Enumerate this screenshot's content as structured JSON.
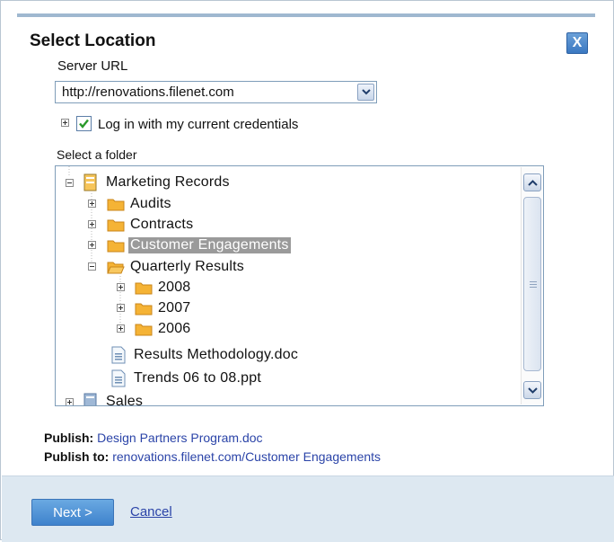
{
  "dialog": {
    "title": "Select Location",
    "close_label": "X"
  },
  "server": {
    "label": "Server URL",
    "url_value": "http://renovations.filenet.com"
  },
  "credentials": {
    "label": "Log in with my current credentials",
    "checked": true
  },
  "folder_section": {
    "label": "Select a folder"
  },
  "tree": {
    "items": [
      {
        "label": "Marketing Records",
        "type": "cabinet",
        "expanded": true
      },
      {
        "label": "Audits",
        "type": "folder",
        "expanded": false
      },
      {
        "label": "Contracts",
        "type": "folder",
        "expanded": false
      },
      {
        "label": "Customer Engagements",
        "type": "folder",
        "expanded": false,
        "selected": true
      },
      {
        "label": "Quarterly Results",
        "type": "folder-open",
        "expanded": true
      },
      {
        "label": "2008",
        "type": "folder",
        "expanded": false
      },
      {
        "label": "2007",
        "type": "folder",
        "expanded": false
      },
      {
        "label": "2006",
        "type": "folder",
        "expanded": false
      },
      {
        "label": "Results Methodology.doc",
        "type": "document"
      },
      {
        "label": "Trends 06 to 08.ppt",
        "type": "document"
      },
      {
        "label": "Sales",
        "type": "cabinet",
        "expanded": false
      }
    ]
  },
  "publish": {
    "label": "Publish:",
    "document": "Design Partners Program.doc",
    "to_label": "Publish to:",
    "destination": "renovations.filenet.com/Customer Engagements"
  },
  "footer": {
    "next_label": "Next >",
    "cancel_label": "Cancel"
  },
  "colors": {
    "accent": "#3e82cc",
    "link": "#2b44a8",
    "selection": "#9a9a9a",
    "folder": "#f5b335",
    "footer_bg": "#dde8f1"
  }
}
